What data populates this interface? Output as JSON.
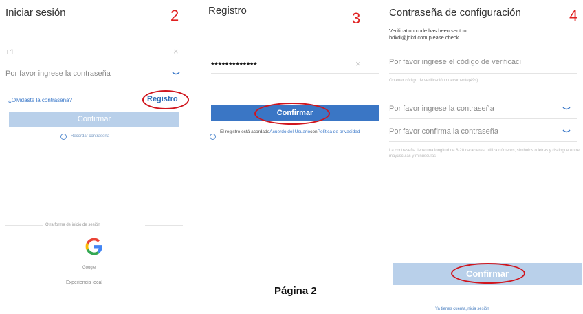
{
  "login": {
    "title": "Iniciar sesión",
    "step": "2",
    "phone_prefix": "+1",
    "password_placeholder": "Por favor ingrese la contraseña",
    "forgot_link": "¿Olvidaste la contraseña?",
    "register_link": "Registro",
    "confirm_button": "Confirmar",
    "remember_label": "Recordar contraseña",
    "other_login_label": "Otra forma de inicio de sesión",
    "google_label": "Google",
    "local_label": "Experiencia local"
  },
  "register": {
    "title": "Registro",
    "step": "3",
    "password_value": "*************",
    "confirm_button": "Confirmar",
    "agree_prefix": "El registro está acordado",
    "user_agreement": "Acuerdo del Usuario",
    "agree_middle": "con",
    "privacy_policy": "Política de privacidad"
  },
  "setup": {
    "title": "Contraseña de configuración",
    "step": "4",
    "verify_line1": "Verification code has been sent to",
    "verify_line2": "hdkdi@jdkd.com,please check.",
    "code_placeholder": "Por favor ingrese el código de verificaci",
    "resend_hint": "Obtener código de verificación nuevamente(49s)",
    "password_placeholder": "Por favor ingrese la contraseña",
    "confirm_password_placeholder": "Por favor confirma la contraseña",
    "rules_text": "La contraseña tiene una longitud de 6-20 caracteres, utiliza números, símbolos o letras y distingue entre mayúsculas y minúsculas",
    "confirm_button": "Confirmar",
    "login_link": "Ya tienes cuenta,inicia sesión"
  },
  "page_label": "Página 2",
  "colors": {
    "highlight_ring": "#d0151d",
    "primary_button": "#3a76c5",
    "disabled_button": "#b9d0ea",
    "link": "#3a78c9",
    "google_blue": "#4285F4",
    "google_red": "#EA4335",
    "google_yellow": "#FBBC05",
    "google_green": "#34A853"
  }
}
